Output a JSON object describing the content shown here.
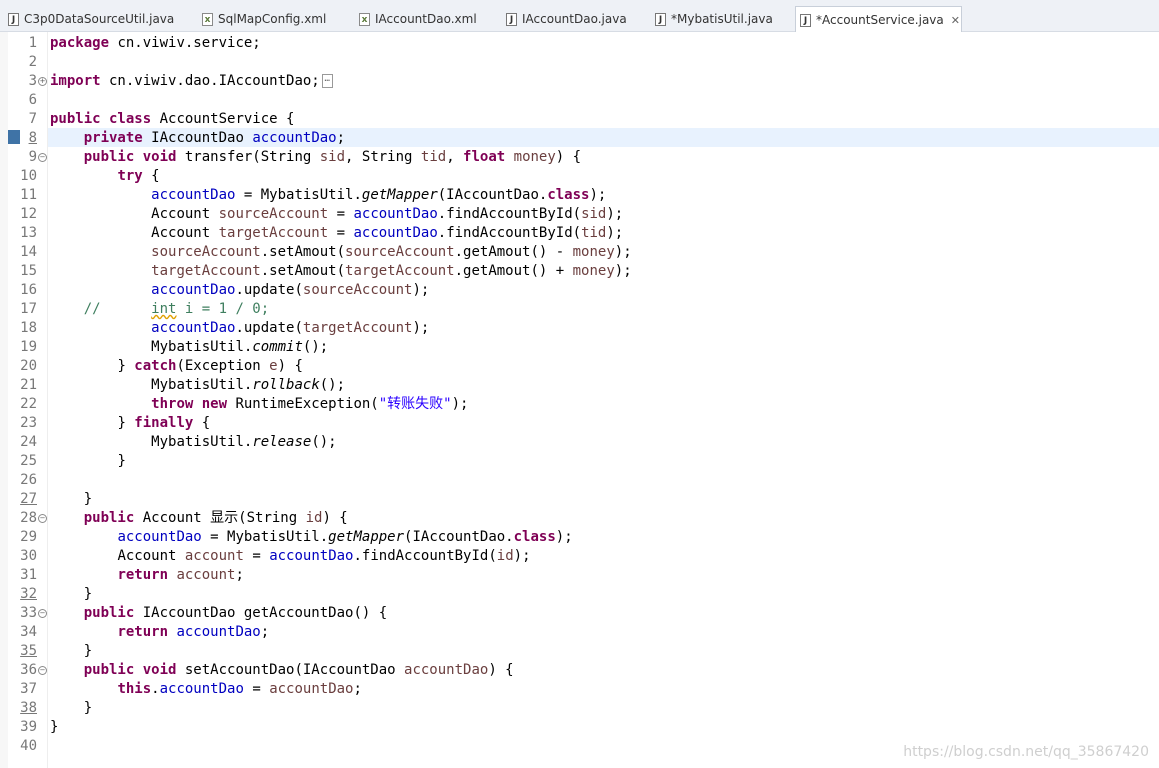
{
  "tabs": [
    {
      "label": "C3p0DataSourceUtil.java",
      "icon": "java-file-icon",
      "glyph": "J"
    },
    {
      "label": "SqlMapConfig.xml",
      "icon": "xml-file-icon",
      "glyph": "x"
    },
    {
      "label": "IAccountDao.xml",
      "icon": "xml-file-icon",
      "glyph": "x"
    },
    {
      "label": "IAccountDao.java",
      "icon": "java-file-icon",
      "glyph": "J"
    },
    {
      "label": "*MybatisUtil.java",
      "icon": "java-file-icon",
      "glyph": "J"
    },
    {
      "label": "*AccountService.java",
      "icon": "java-file-icon",
      "glyph": "J",
      "active": true
    }
  ],
  "close_glyph": "✕",
  "fold_expand_glyph": "+",
  "fold_collapse_glyph": "−",
  "line_numbers": [
    "1",
    "2",
    "3",
    "6",
    "7",
    "8",
    "9",
    "10",
    "11",
    "12",
    "13",
    "14",
    "15",
    "16",
    "17",
    "18",
    "19",
    "20",
    "21",
    "22",
    "23",
    "24",
    "25",
    "26",
    "27",
    "28",
    "29",
    "30",
    "31",
    "32",
    "33",
    "34",
    "35",
    "36",
    "37",
    "38",
    "39",
    "40"
  ],
  "code": {
    "l1": {
      "kw": "package",
      "t": " cn.viwiv.service;"
    },
    "l3": {
      "kw": "import",
      "t": " cn.viwiv.dao.IAccountDao;"
    },
    "l7": {
      "kw": "public class",
      "t": " AccountService {"
    },
    "l8": {
      "kw": "private",
      "t1": " IAccountDao ",
      "f": "accountDao",
      "t2": ";"
    },
    "l9": {
      "kw": "public void",
      "t1": " transfer(String ",
      "v1": "sid",
      "t2": ", String ",
      "v2": "tid",
      "t3": ", ",
      "kw2": "float",
      "t4": " ",
      "v3": "money",
      "t5": ") {"
    },
    "l10": {
      "kw": "try",
      "t": " {"
    },
    "l11": {
      "f": "accountDao",
      "t1": " = MybatisUtil.",
      "i": "getMapper",
      "t2": "(IAccountDao.",
      "kw": "class",
      "t3": ");"
    },
    "l12": {
      "t1": "Account ",
      "v": "sourceAccount",
      "t2": " = ",
      "f": "accountDao",
      "t3": ".findAccountById(",
      "v2": "sid",
      "t4": ");"
    },
    "l13": {
      "t1": "Account ",
      "v": "targetAccount",
      "t2": " = ",
      "f": "accountDao",
      "t3": ".findAccountById(",
      "v2": "tid",
      "t4": ");"
    },
    "l14": {
      "v1": "sourceAccount",
      "t1": ".setAmout(",
      "v2": "sourceAccount",
      "t2": ".getAmout() - ",
      "v3": "money",
      "t3": ");"
    },
    "l15": {
      "v1": "targetAccount",
      "t1": ".setAmout(",
      "v2": "targetAccount",
      "t2": ".getAmout() + ",
      "v3": "money",
      "t3": ");"
    },
    "l16": {
      "f": "accountDao",
      "t1": ".update(",
      "v": "sourceAccount",
      "t2": ");"
    },
    "l17": {
      "c1": "//      ",
      "c2": "int",
      "c3": " i = 1 / 0;"
    },
    "l18": {
      "f": "accountDao",
      "t1": ".update(",
      "v": "targetAccount",
      "t2": ");"
    },
    "l19": {
      "t1": "MybatisUtil.",
      "i": "commit",
      "t2": "();"
    },
    "l20": {
      "t1": "} ",
      "kw": "catch",
      "t2": "(Exception ",
      "v": "e",
      "t3": ") {"
    },
    "l21": {
      "t1": "MybatisUtil.",
      "i": "rollback",
      "t2": "();"
    },
    "l22": {
      "kw": "throw new",
      "t1": " RuntimeException(",
      "s": "\"转账失败\"",
      "t2": ");"
    },
    "l23": {
      "t1": "} ",
      "kw": "finally",
      "t2": " {"
    },
    "l24": {
      "t1": "MybatisUtil.",
      "i": "release",
      "t2": "();"
    },
    "l25": {
      "t": "}"
    },
    "l27": {
      "t": "}"
    },
    "l28": {
      "kw": "public",
      "t1": " Account 显示(String ",
      "v": "id",
      "t2": ") {"
    },
    "l29": {
      "f": "accountDao",
      "t1": " = MybatisUtil.",
      "i": "getMapper",
      "t2": "(IAccountDao.",
      "kw": "class",
      "t3": ");"
    },
    "l30": {
      "t1": "Account ",
      "v": "account",
      "t2": " = ",
      "f": "accountDao",
      "t3": ".findAccountById(",
      "v2": "id",
      "t4": ");"
    },
    "l31": {
      "kw": "return",
      "t1": " ",
      "v": "account",
      "t2": ";"
    },
    "l32": {
      "t": "}"
    },
    "l33": {
      "kw": "public",
      "t": " IAccountDao getAccountDao() {"
    },
    "l34": {
      "kw": "return",
      "t1": " ",
      "f": "accountDao",
      "t2": ";"
    },
    "l35": {
      "t": "}"
    },
    "l36": {
      "kw": "public void",
      "t1": " setAccountDao(IAccountDao ",
      "v": "accountDao",
      "t2": ") {"
    },
    "l37": {
      "kw": "this",
      "t1": ".",
      "f": "accountDao",
      "t2": " = ",
      "v": "accountDao",
      "t3": ";"
    },
    "l38": {
      "t": "}"
    },
    "l39": {
      "t": "}"
    }
  },
  "watermark": "https://blog.csdn.net/qq_35867420"
}
